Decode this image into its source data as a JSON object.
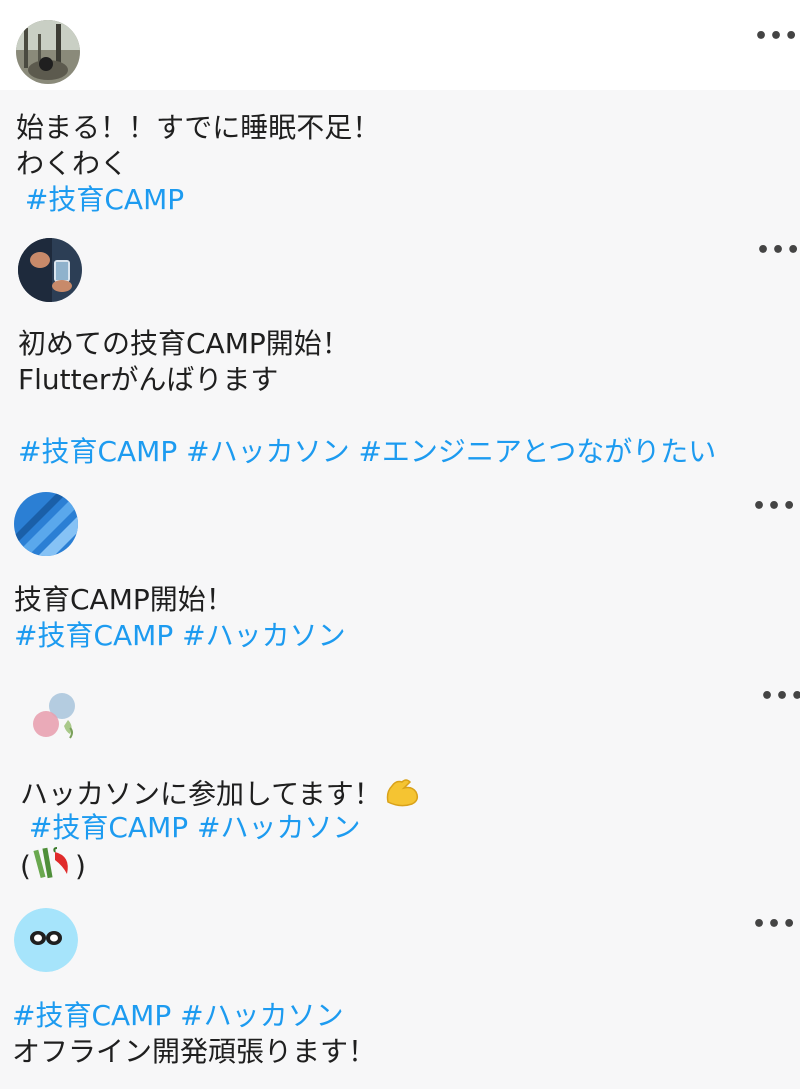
{
  "posts": [
    {
      "lines": [
        "始まる！！すでに睡眠不足！",
        "わくわく"
      ],
      "tags": " #技育CAMP"
    },
    {
      "lines": [
        "初めての技育CAMP開始！",
        "Flutterがんばります"
      ],
      "tags": "#技育CAMP #ハッカソン #エンジニアとつながりたい"
    },
    {
      "lines": [
        "技育CAMP開始！"
      ],
      "tags": "#技育CAMP #ハッカソン"
    },
    {
      "lines": [
        "ハッカソンに参加してます！"
      ],
      "tags": " #技育CAMP #ハッカソン",
      "extra_open": "(",
      "extra_close": ")"
    },
    {
      "tags": "#技育CAMP #ハッカソン",
      "lines": [
        "オフライン開発頑張ります！"
      ]
    }
  ],
  "more_label": "•••",
  "colors": {
    "hashtag": "#1d9bf0",
    "text": "#1f1f1f",
    "background": "#f7f7f8"
  },
  "icons": [
    "more-icon",
    "flexed-biceps-emoji",
    "bamboo-pepper-emoji",
    "sleepy-eyes-avatar"
  ]
}
